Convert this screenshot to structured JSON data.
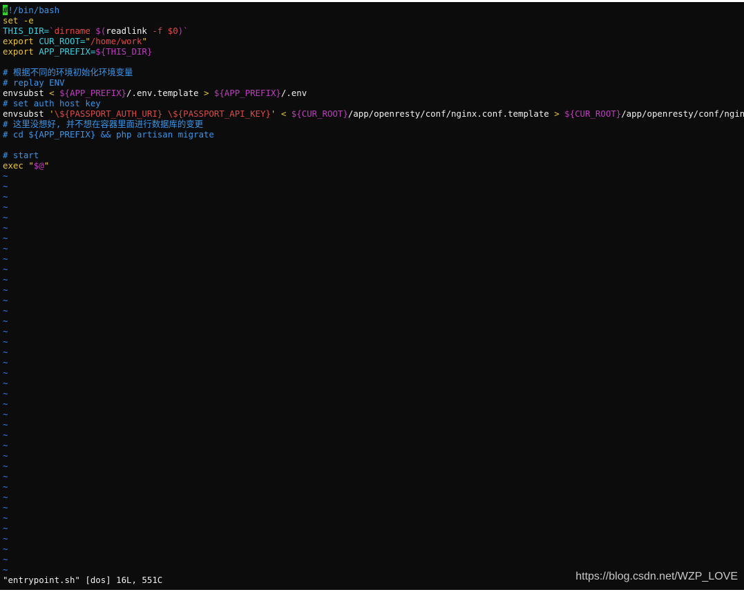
{
  "editor": {
    "lines": [
      [
        {
          "t": "#",
          "c": "cursor"
        },
        {
          "t": "!/bin/bash",
          "c": "comment"
        }
      ],
      [
        {
          "t": "set -e",
          "c": "keyword"
        }
      ],
      [
        {
          "t": "THIS_DIR=",
          "c": "var"
        },
        {
          "t": "`",
          "c": "subst"
        },
        {
          "t": "dirname ",
          "c": "string"
        },
        {
          "t": "$(",
          "c": "subst"
        },
        {
          "t": "readlink ",
          "c": "plain"
        },
        {
          "t": "-f $0",
          "c": "string"
        },
        {
          "t": ")`",
          "c": "subst"
        }
      ],
      [
        {
          "t": "export ",
          "c": "keyword"
        },
        {
          "t": "CUR_ROOT=",
          "c": "var"
        },
        {
          "t": "\"",
          "c": "keyword"
        },
        {
          "t": "/home/work",
          "c": "string"
        },
        {
          "t": "\"",
          "c": "keyword"
        }
      ],
      [
        {
          "t": "export ",
          "c": "keyword"
        },
        {
          "t": "APP_PREFIX=",
          "c": "var"
        },
        {
          "t": "${THIS_DIR}",
          "c": "subst"
        }
      ],
      [],
      [
        {
          "t": "# 根据不同的环境初始化环境变量",
          "c": "comment"
        }
      ],
      [
        {
          "t": "# replay ENV",
          "c": "comment"
        }
      ],
      [
        {
          "t": "envsubst ",
          "c": "plain"
        },
        {
          "t": "< ",
          "c": "keyword"
        },
        {
          "t": "${APP_PREFIX}",
          "c": "subst"
        },
        {
          "t": "/.env.template ",
          "c": "plain"
        },
        {
          "t": "> ",
          "c": "keyword"
        },
        {
          "t": "${APP_PREFIX}",
          "c": "subst"
        },
        {
          "t": "/.env",
          "c": "plain"
        }
      ],
      [
        {
          "t": "# set auth host key",
          "c": "comment"
        }
      ],
      [
        {
          "t": "envsubst ",
          "c": "plain"
        },
        {
          "t": "'",
          "c": "keyword"
        },
        {
          "t": "\\${PASSPORT_AUTH_URI} \\${PASSPORT_API_KEY}",
          "c": "string"
        },
        {
          "t": "' ",
          "c": "keyword"
        },
        {
          "t": "< ",
          "c": "keyword"
        },
        {
          "t": "${CUR_ROOT}",
          "c": "subst"
        },
        {
          "t": "/app/openresty/conf/nginx.conf.template ",
          "c": "plain"
        },
        {
          "t": "> ",
          "c": "keyword"
        },
        {
          "t": "${CUR_ROOT}",
          "c": "subst"
        },
        {
          "t": "/app/openresty/conf/nginx.conf",
          "c": "plain"
        }
      ],
      [
        {
          "t": "# 这里没想好, 并不想在容器里面进行数据库的变更",
          "c": "comment"
        }
      ],
      [
        {
          "t": "# cd ${APP_PREFIX} && php artisan migrate",
          "c": "comment"
        }
      ],
      [],
      [
        {
          "t": "# start",
          "c": "comment"
        }
      ],
      [
        {
          "t": "exec ",
          "c": "keyword"
        },
        {
          "t": "\"",
          "c": "keyword"
        },
        {
          "t": "$@",
          "c": "subst"
        },
        {
          "t": "\"",
          "c": "keyword"
        }
      ]
    ],
    "tilde_char": "~",
    "tilde_count": 39
  },
  "statusline": {
    "text": "\"entrypoint.sh\" [dos] 16L, 551C"
  },
  "watermark": {
    "text": "https://blog.csdn.net/WZP_LOVE"
  }
}
